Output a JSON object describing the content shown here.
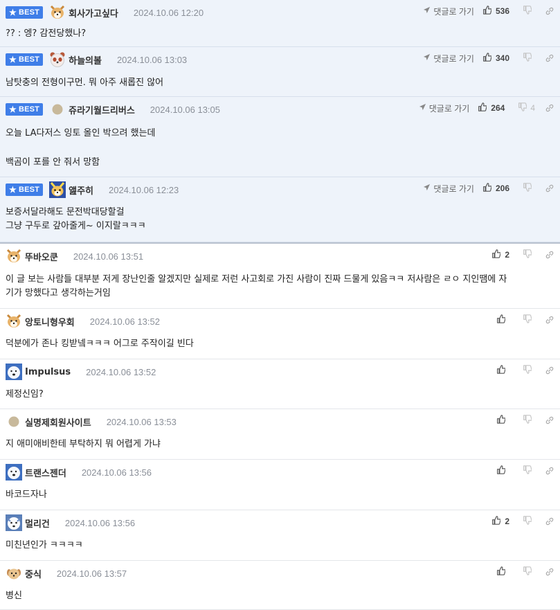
{
  "labels": {
    "best": "BEST",
    "goto_reply": "댓글로 가기"
  },
  "colors": {
    "best_badge": "#3f7ee8",
    "best_bg": "#eef3fa"
  },
  "comments": [
    {
      "best": true,
      "nick": "회사가고싶다",
      "date": "2024.10.06 12:20",
      "avatar": "shiba-avatar",
      "lines": [
        "?? : 엥? 감전당했나?"
      ],
      "up": "536",
      "down": ""
    },
    {
      "best": true,
      "nick": "하늘의볼",
      "date": "2024.10.06 13:03",
      "avatar": "panda-avatar",
      "lines": [
        "남탓충의 전형이구먼. 뭐 아주 새롭진 않어"
      ],
      "up": "340",
      "down": ""
    },
    {
      "best": true,
      "nick": "쥬라기월드리버스",
      "date": "2024.10.06 13:05",
      "avatar": "dot-avatar",
      "lines": [
        "오늘 LA다저스 잉토 올인 박으려 했는데",
        "",
        "백곰이 포를 안 줘서 망함"
      ],
      "up": "264",
      "down": "4"
    },
    {
      "best": true,
      "nick": "앮주히",
      "date": "2024.10.06 12:23",
      "avatar": "fox-avatar",
      "lines": [
        "보증서달라해도 문전박대당할걸",
        "그냥 구두로 갚아줄게~ 이지랄ㅋㅋㅋ"
      ],
      "up": "206",
      "down": ""
    },
    {
      "best": false,
      "nick": "뚜바오쿤",
      "date": "2024.10.06 13:51",
      "avatar": "shiba-avatar",
      "lines": [
        "이 글 보는 사람들 대부분 저게 장난인줄 알겠지만 실제로 저런 사고회로 가진 사람이 진짜 드물게 있음ㅋㅋ 저사람은 ㄹㅇ 지인땜에 자",
        "기가 망했다고 생각하는거임"
      ],
      "up": "2",
      "down": ""
    },
    {
      "best": false,
      "nick": "앙토니형우회",
      "date": "2024.10.06 13:52",
      "avatar": "shiba-avatar",
      "lines": [
        "덕분에가 존나 킹받넼ㅋㅋㅋ 어그로 주작이길 빈다"
      ],
      "up": "",
      "down": ""
    },
    {
      "best": false,
      "nick": "Impulsus",
      "date": "2024.10.06 13:52",
      "avatar": "bear-avatar",
      "lines": [
        "제정신임?"
      ],
      "up": "",
      "down": ""
    },
    {
      "best": false,
      "nick": "실명제회원사이트",
      "date": "2024.10.06 13:53",
      "avatar": "dot-avatar",
      "lines": [
        "지 애미애비한테 부탁하지 뭐 어렵게 가냐"
      ],
      "up": "",
      "down": ""
    },
    {
      "best": false,
      "nick": "트랜스젠더",
      "date": "2024.10.06 13:56",
      "avatar": "bear-avatar",
      "lines": [
        "바코드자나"
      ],
      "up": "",
      "down": ""
    },
    {
      "best": false,
      "nick": "멀리건",
      "date": "2024.10.06 13:56",
      "avatar": "bear2-avatar",
      "lines": [
        "미친년인가 ㅋㅋㅋㅋ"
      ],
      "up": "2",
      "down": ""
    },
    {
      "best": false,
      "nick": "중식",
      "date": "2024.10.06 13:57",
      "avatar": "puppy-avatar",
      "lines": [
        "병신"
      ],
      "up": "",
      "down": ""
    }
  ]
}
